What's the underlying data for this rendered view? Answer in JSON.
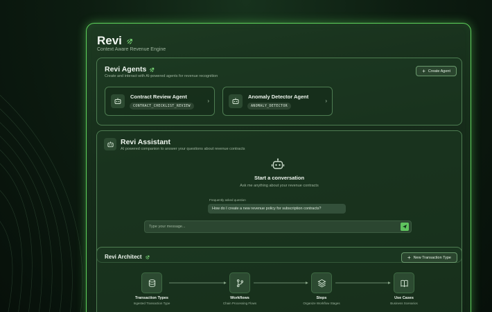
{
  "app": {
    "title": "Revi",
    "subtitle": "Context Aware Revenue Engine"
  },
  "agents": {
    "title": "Revi Agents",
    "subtitle": "Create and interact with AI-powered agents for revenue recognition",
    "create_label": "Create Agent",
    "items": [
      {
        "name": "Contract Review Agent",
        "tag": "CONTRACT_CHECKLIST_REVIEW",
        "icon": "robot-icon"
      },
      {
        "name": "Anomaly Detector Agent",
        "tag": "ANOMALY_DETECTOR",
        "icon": "robot-icon"
      }
    ]
  },
  "assistant": {
    "title": "Revi Assistant",
    "subtitle": "AI powered companion to answer your questions about revenue contracts",
    "start_title": "Start a conversation",
    "start_subtitle": "Ask me anything about your revenue contracts",
    "faq_label": "Frequently asked question",
    "faq_question": "How do I create a new revenue policy for subscription contracts?",
    "input_placeholder": "Type your message...",
    "input_value": ""
  },
  "architect": {
    "title": "Revi Architect",
    "new_label": "New Transaction Type",
    "nodes": [
      {
        "label": "Transaction Types",
        "sub": "Ingested Transaction Type",
        "icon": "database-icon"
      },
      {
        "label": "Workflows",
        "sub": "Chain Processing Flows",
        "icon": "git-branch-icon"
      },
      {
        "label": "Steps",
        "sub": "Organize Workflow Stages",
        "icon": "layers-icon"
      },
      {
        "label": "Use Cases",
        "sub": "Business Scenarios",
        "icon": "book-icon"
      }
    ]
  },
  "colors": {
    "accent": "#5fd35c",
    "panel": "#1d3a22",
    "border": "#4e7d52"
  }
}
